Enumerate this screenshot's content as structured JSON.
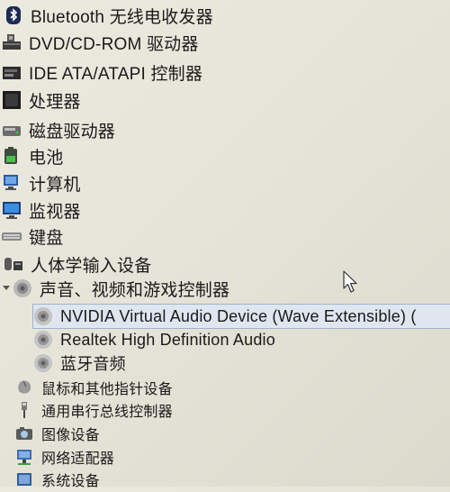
{
  "device_tree": {
    "categories": [
      {
        "label": "Bluetooth 无线电收发器",
        "icon": "bluetooth-icon"
      },
      {
        "label": "DVD/CD-ROM 驱动器",
        "icon": "optical-drive-icon"
      },
      {
        "label": "IDE ATA/ATAPI 控制器",
        "icon": "ide-controller-icon"
      },
      {
        "label": "处理器",
        "icon": "processor-icon"
      },
      {
        "label": "磁盘驱动器",
        "icon": "disk-drive-icon"
      },
      {
        "label": "电池",
        "icon": "battery-icon"
      },
      {
        "label": "计算机",
        "icon": "computer-icon"
      },
      {
        "label": "监视器",
        "icon": "monitor-icon"
      },
      {
        "label": "键盘",
        "icon": "keyboard-icon"
      },
      {
        "label": "人体学输入设备",
        "icon": "hid-icon"
      },
      {
        "label": "声音、视频和游戏控制器",
        "icon": "speaker-icon",
        "expanded": true
      }
    ],
    "audio_children": [
      {
        "label": "NVIDIA Virtual Audio Device (Wave Extensible) (",
        "icon": "audio-device-icon",
        "selected": true
      },
      {
        "label": "Realtek High Definition Audio",
        "icon": "audio-device-icon"
      },
      {
        "label": "蓝牙音频",
        "icon": "audio-device-icon"
      }
    ],
    "more_categories": [
      {
        "label": "鼠标和其他指针设备",
        "icon": "mouse-icon"
      },
      {
        "label": "通用串行总线控制器",
        "icon": "usb-icon"
      },
      {
        "label": "图像设备",
        "icon": "camera-icon"
      },
      {
        "label": "网络适配器",
        "icon": "network-adapter-icon"
      },
      {
        "label": "系统设备",
        "icon": "system-device-icon"
      }
    ]
  },
  "colors": {
    "selection_background": "#dfe6ef",
    "selection_border": "#9fb3ca",
    "background": "#e8e6da"
  }
}
